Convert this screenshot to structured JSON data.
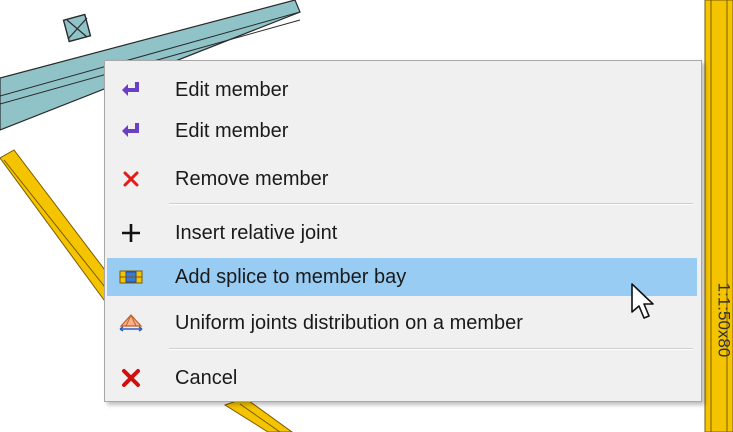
{
  "menu": {
    "items": [
      {
        "label": "Edit member",
        "icon": "enter-arrow-icon"
      },
      {
        "label": "Edit member",
        "icon": "enter-arrow-icon"
      },
      {
        "label": "Remove member",
        "icon": "red-x-icon"
      },
      {
        "label": "Insert relative joint",
        "icon": "plus-icon"
      },
      {
        "label": "Add splice to member bay",
        "icon": "splice-icon",
        "highlighted": true
      },
      {
        "label": "Uniform joints distribution on a member",
        "icon": "joints-distribution-icon"
      },
      {
        "label": "Cancel",
        "icon": "cancel-x-icon"
      }
    ]
  },
  "drawing": {
    "member_label": "1:1:50x80",
    "colors": {
      "member_yellow": "#f5c400",
      "member_outline": "#7a5a00",
      "selected_beam": "#8fc3c7",
      "highlight": "#99ccf3"
    }
  }
}
